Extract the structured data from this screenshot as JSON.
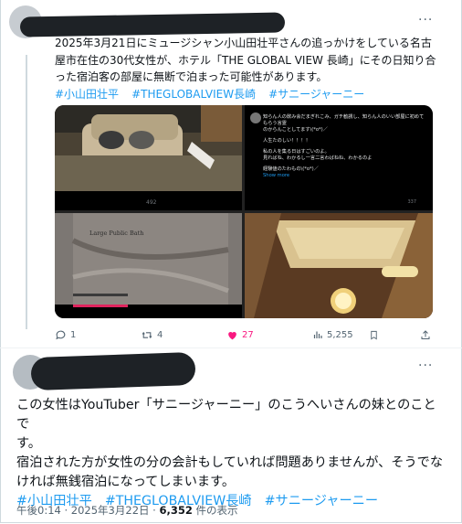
{
  "tweet1": {
    "more_label": "···",
    "text_lines": [
      "2025年3月21日にミュージシャン小山田壮平さんの追っかけをしている名古",
      "屋市在住の30代女性が、ホテル「THE GLOBAL VIEW 長崎」にその日知り合",
      "った宿泊客の部屋に無断で泊まった可能性があります。"
    ],
    "hashtags": [
      "#小山田壮平",
      "#THEGLOBALVIEW長崎",
      "#サニージャーニー"
    ],
    "media": {
      "q2": {
        "lines": [
          "知らん人の飲み会だまぎれこみ、ガチ勧誘し、知らん人のいい部屋に初めてもらう言霊",
          "のからんことしてます\\(*o*)／",
          "",
          "人生たのしい！！！！",
          "",
          "私の人を集る日はすごいのよ。",
          "見ればね、わかるし一言二言わばねね、わかるのよ",
          "",
          "経験値のたわもの\\(*o*)／",
          ""
        ],
        "show_more": "Show more",
        "q2_views": "337"
      },
      "q1_views": "492",
      "q3_sign": "Large Public Bath"
    },
    "actions": {
      "replies": "1",
      "reposts": "4",
      "likes": "27",
      "views": "5,255"
    }
  },
  "tweet2": {
    "more_label": "···",
    "text_lines": [
      "この女性はYouTuber「サニージャーニー」のこうへいさんの妹とのことで",
      "す。",
      "宿泊された方が女性の分の会計もしていれば問題ありませんが、そうでな",
      "ければ無銭宿泊になってしまいます。"
    ],
    "hashtags": [
      "#小山田壮平",
      "#THEGLOBALVIEW長崎",
      "#サニージャーニー"
    ],
    "timestamp": "午後0:14 · 2025年3月22日 · ",
    "views": "6,352",
    "views_suffix": " 件の表示"
  },
  "colors": {
    "link": "#1d9bf0",
    "like": "#f91880",
    "muted": "#536471"
  }
}
